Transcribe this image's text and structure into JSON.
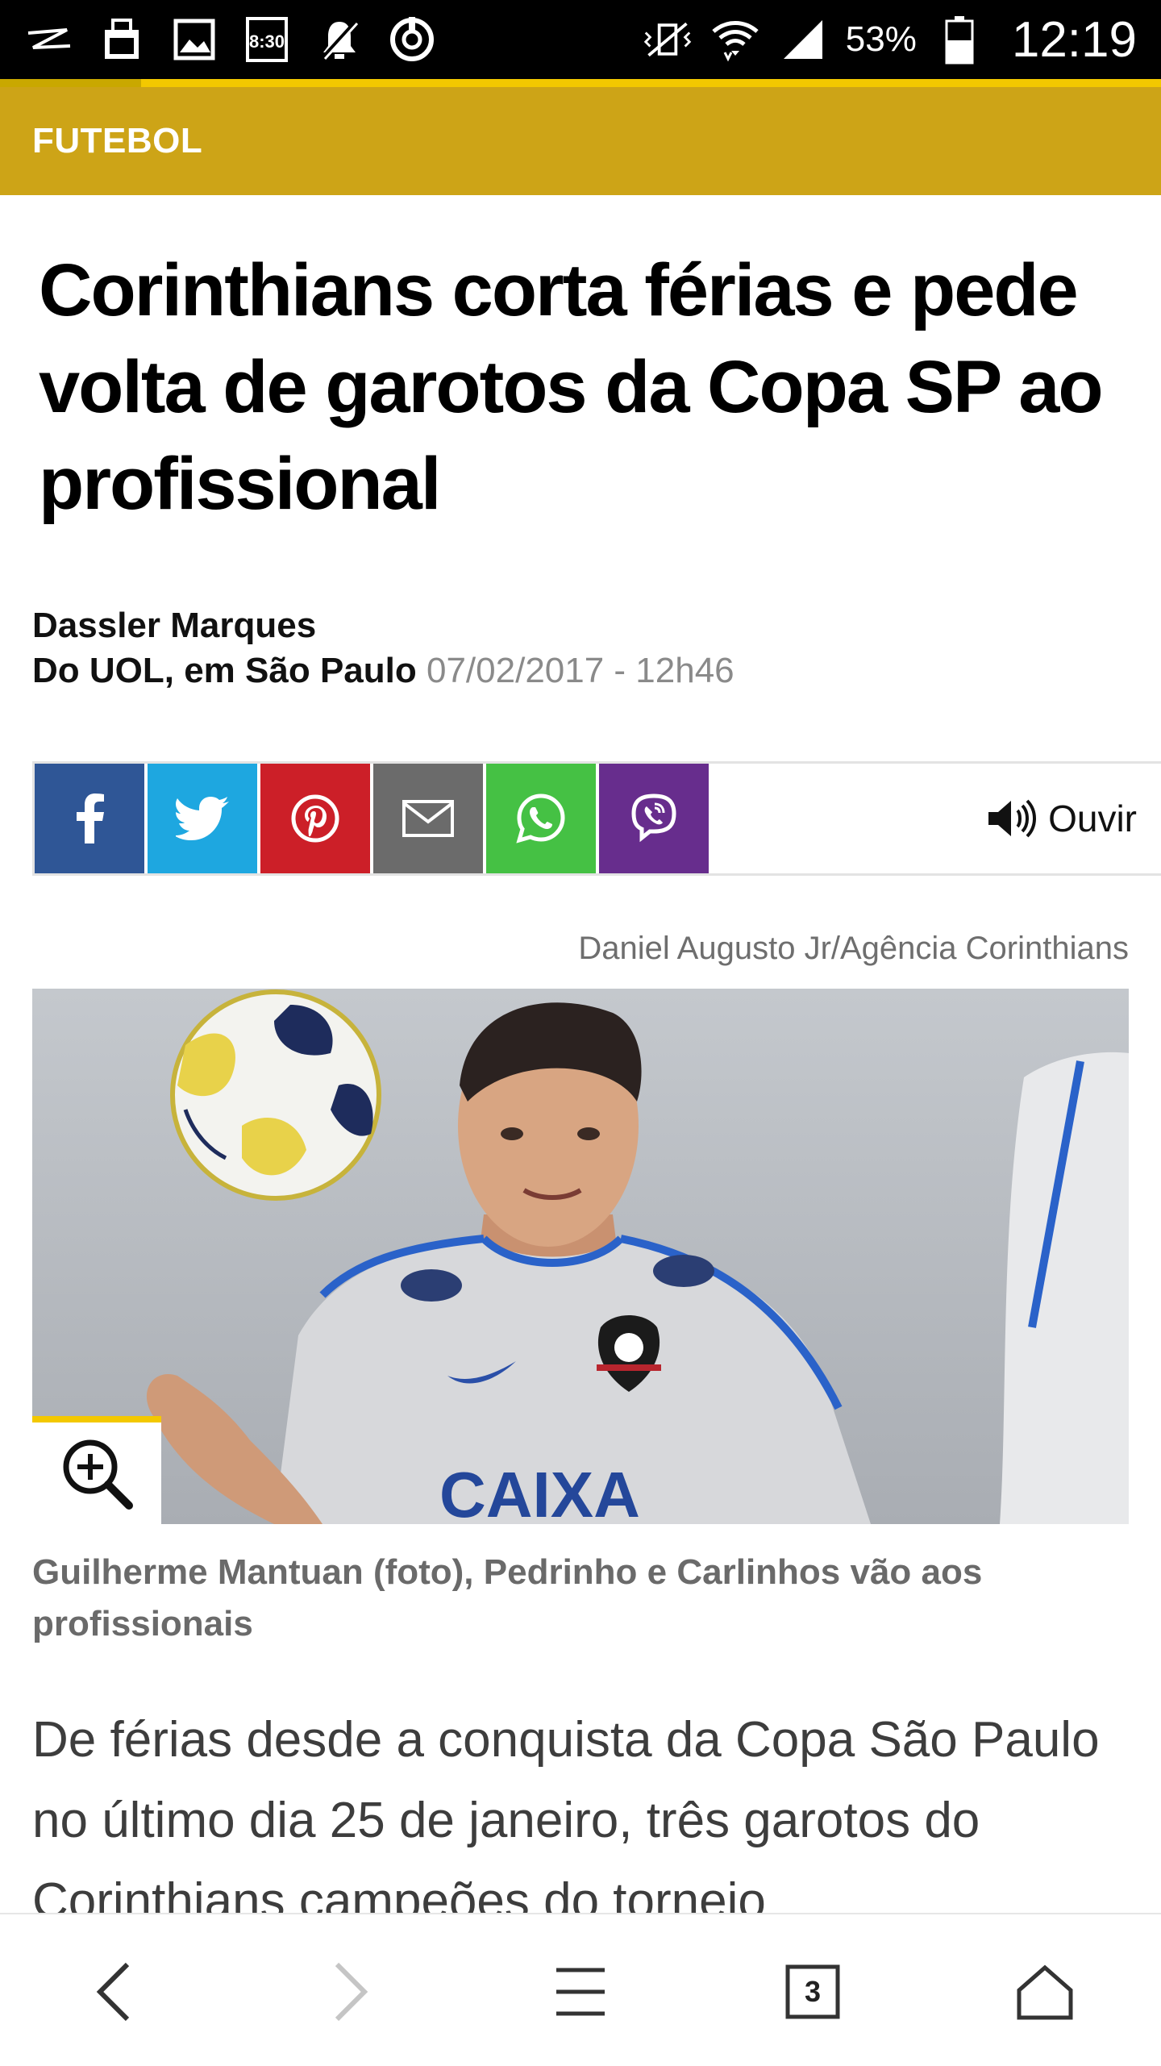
{
  "status_bar": {
    "left_icons": [
      "zap-icon",
      "clipboard-icon",
      "gallery-icon",
      "clock-widget-icon",
      "mute-icon",
      "sync-icon"
    ],
    "right_icons": [
      "vibrate-icon",
      "wifi-icon",
      "signal-icon"
    ],
    "battery_percent": "53%",
    "time": "12:19"
  },
  "section": {
    "label": "FUTEBOL"
  },
  "article": {
    "headline": "Corinthians corta férias e pede volta de garotos da Copa SP ao profissional",
    "author": "Dassler Marques",
    "origin": "Do UOL, em São Paulo",
    "date": "07/02/2017 - 12h46",
    "photo_credit": "Daniel Augusto Jr/Agência Corinthians",
    "photo_caption": "Guilherme Mantuan (foto), Pedrinho e Carlinhos vão aos profissionais",
    "body_start": "De férias desde a conquista da Copa São Paulo no último dia 25 de janeiro, três garotos do Corinthians campeões do torneio"
  },
  "share": {
    "buttons": [
      {
        "name": "facebook",
        "color": "#2f5696"
      },
      {
        "name": "twitter",
        "color": "#1ea7e0"
      },
      {
        "name": "pinterest",
        "color": "#cc1f28"
      },
      {
        "name": "email",
        "color": "#6b6b6b"
      },
      {
        "name": "whatsapp",
        "color": "#45c144"
      },
      {
        "name": "viber",
        "color": "#672d8d"
      }
    ],
    "listen_label": "Ouvir"
  },
  "browser_nav": {
    "tabs_count": "3"
  },
  "colors": {
    "section_bar": "#cda417",
    "accent_yellow": "#f3c800"
  }
}
